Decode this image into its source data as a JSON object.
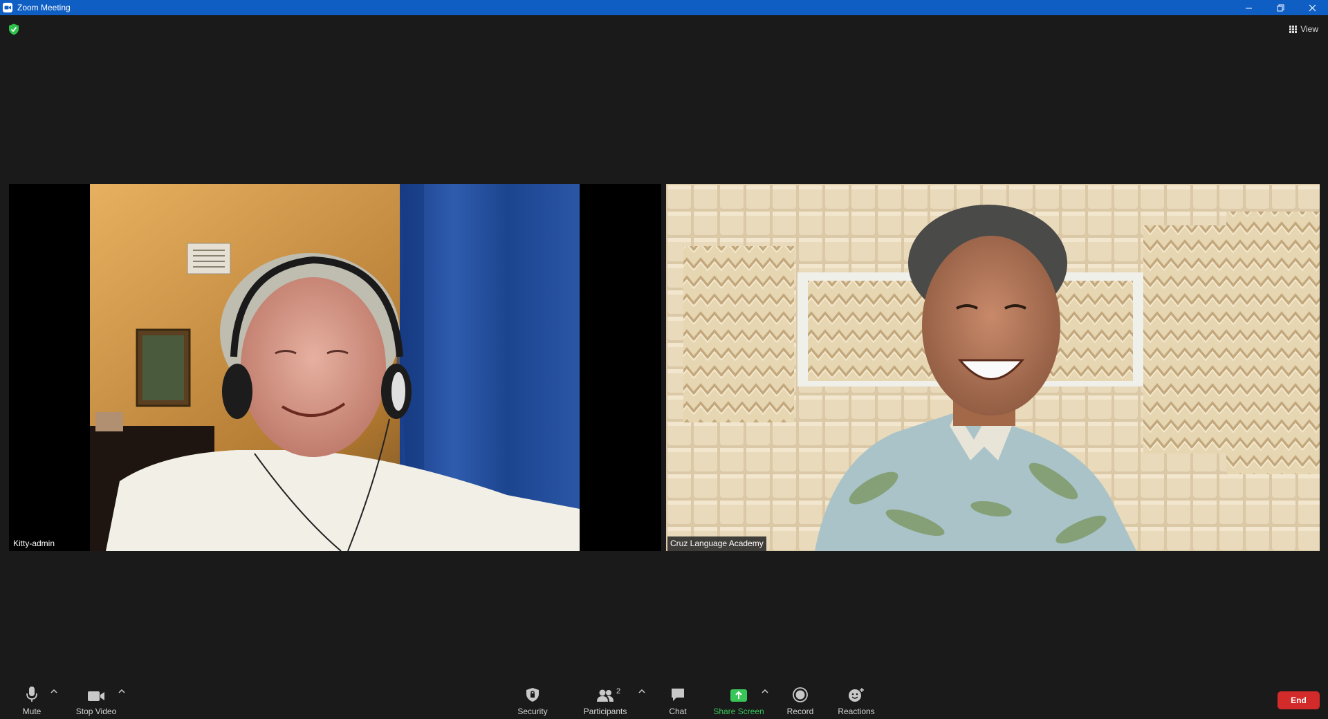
{
  "window": {
    "title": "Zoom Meeting"
  },
  "topbar": {
    "view_label": "View"
  },
  "participants": [
    {
      "name": "Kitty-admin"
    },
    {
      "name": "Cruz Language Academy"
    }
  ],
  "toolbar": {
    "mute_label": "Mute",
    "stop_video_label": "Stop Video",
    "security_label": "Security",
    "participants_label": "Participants",
    "participants_count": "2",
    "chat_label": "Chat",
    "share_screen_label": "Share Screen",
    "record_label": "Record",
    "reactions_label": "Reactions",
    "end_label": "End"
  },
  "colors": {
    "titlebar": "#0e5ec4",
    "background": "#1a1a1a",
    "share_green": "#39c659",
    "end_red": "#d32a2a",
    "security_shield": "#2ec24a"
  }
}
